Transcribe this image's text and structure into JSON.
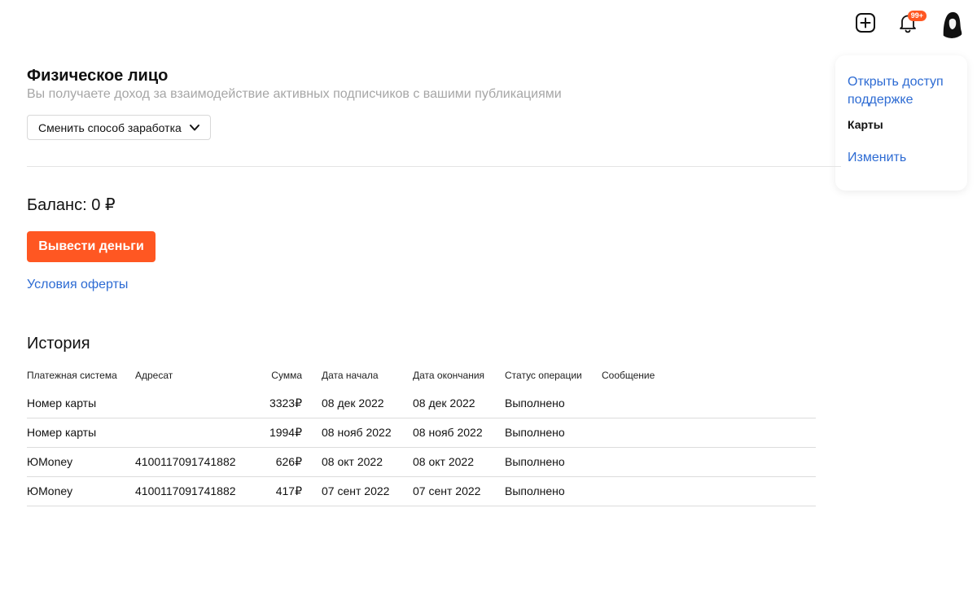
{
  "header": {
    "notifications_badge": "99+"
  },
  "side_panel": {
    "support_link": "Открыть доступ поддержке",
    "cards_label": "Карты",
    "change_link": "Изменить"
  },
  "account": {
    "title": "Физическое лицо",
    "subtitle": "Вы получаете доход за взаимодействие активных подписчиков с вашими публикациями",
    "change_mode_label": "Сменить способ заработка"
  },
  "balance": {
    "label": "Баланс: 0 ₽",
    "withdraw_label": "Вывести деньги",
    "offer_link": "Условия оферты"
  },
  "history": {
    "title": "История",
    "columns": {
      "system": "Платежная система",
      "recipient": "Адресат",
      "amount": "Сумма",
      "start_date": "Дата начала",
      "end_date": "Дата окончания",
      "status": "Статус операции",
      "message": "Сообщение"
    },
    "rows": [
      {
        "system": "Номер карты",
        "recipient": "",
        "amount": "3323₽",
        "start_date": "08 дек 2022",
        "end_date": "08 дек 2022",
        "status": "Выполнено",
        "message": ""
      },
      {
        "system": "Номер карты",
        "recipient": "",
        "amount": "1994₽",
        "start_date": "08 нояб 2022",
        "end_date": "08 нояб 2022",
        "status": "Выполнено",
        "message": ""
      },
      {
        "system": "ЮMoney",
        "recipient": "4100117091741882",
        "amount": "626₽",
        "start_date": "08 окт 2022",
        "end_date": "08 окт 2022",
        "status": "Выполнено",
        "message": ""
      },
      {
        "system": "ЮMoney",
        "recipient": "4100117091741882",
        "amount": "417₽",
        "start_date": "07 сент 2022",
        "end_date": "07 сент 2022",
        "status": "Выполнено",
        "message": ""
      }
    ]
  },
  "colors": {
    "accent": "#ff5722",
    "link": "#2d6bd3",
    "muted_text": "#a6a6a6"
  },
  "icons": [
    "plus-square-icon",
    "bell-icon",
    "chevron-down-icon"
  ]
}
